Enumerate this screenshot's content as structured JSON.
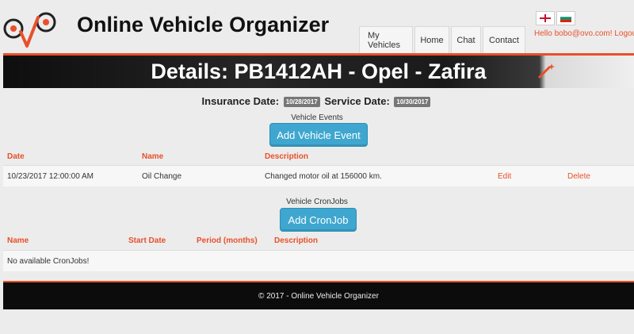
{
  "header": {
    "site_title": "Online Vehicle Organizer",
    "nav": [
      "My Vehicles",
      "Home",
      "Chat",
      "Contact"
    ],
    "greeting": "Hello bobo@ovo.com!",
    "logout": "Logout"
  },
  "banner": {
    "title": "Details: PB1412AH - Opel - Zafira"
  },
  "dates": {
    "insurance_label": "Insurance Date:",
    "insurance_value": "10/28/2017",
    "service_label": "Service Date:",
    "service_value": "10/30/2017"
  },
  "events": {
    "section_label": "Vehicle Events",
    "add_button": "Add Vehicle Event",
    "columns": [
      "Date",
      "Name",
      "Description"
    ],
    "rows": [
      {
        "date": "10/23/2017 12:00:00 AM",
        "name": "Oil Change",
        "description": "Changed motor oil at 156000 km.",
        "edit": "Edit",
        "delete": "Delete"
      }
    ]
  },
  "cronjobs": {
    "section_label": "Vehicle CronJobs",
    "add_button": "Add CronJob",
    "columns": [
      "Name",
      "Start Date",
      "Period (months)",
      "Description"
    ],
    "empty_text": "No available CronJobs!"
  },
  "footer": {
    "text": "© 2017 - Online Vehicle Organizer"
  },
  "colors": {
    "accent": "#e8502a",
    "button": "#3fa7cf",
    "footer_bg": "#0c0c0c"
  }
}
